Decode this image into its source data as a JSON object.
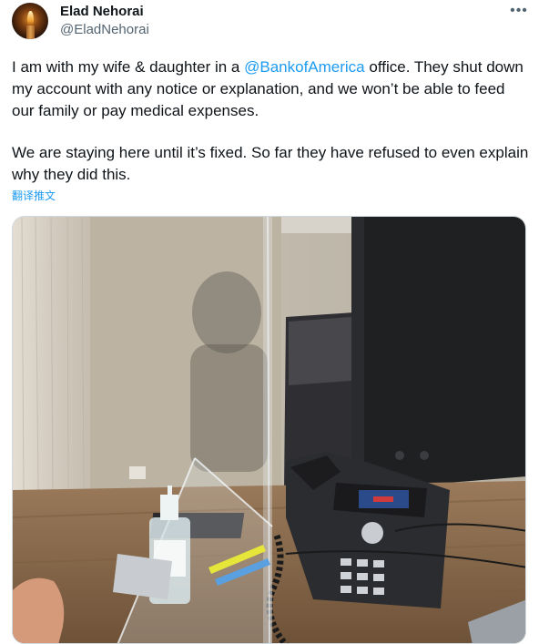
{
  "tweet": {
    "author_name": "Elad Nehorai",
    "author_handle": "@EladNehorai",
    "more_icon": "more-horizontal-icon",
    "text_before_mention": "I am with my wife & daughter in a ",
    "mention": "@BankofAmerica",
    "text_after_mention": " office. They shut down my account with any notice or explanation, and we won’t be able to feed our family or pay medical expenses.",
    "paragraph_2": "We are staying here until it’s fixed. So far they have refused to even explain why they did this.",
    "translate_label": "翻译推文",
    "accent_color": "#1d9bf0"
  }
}
